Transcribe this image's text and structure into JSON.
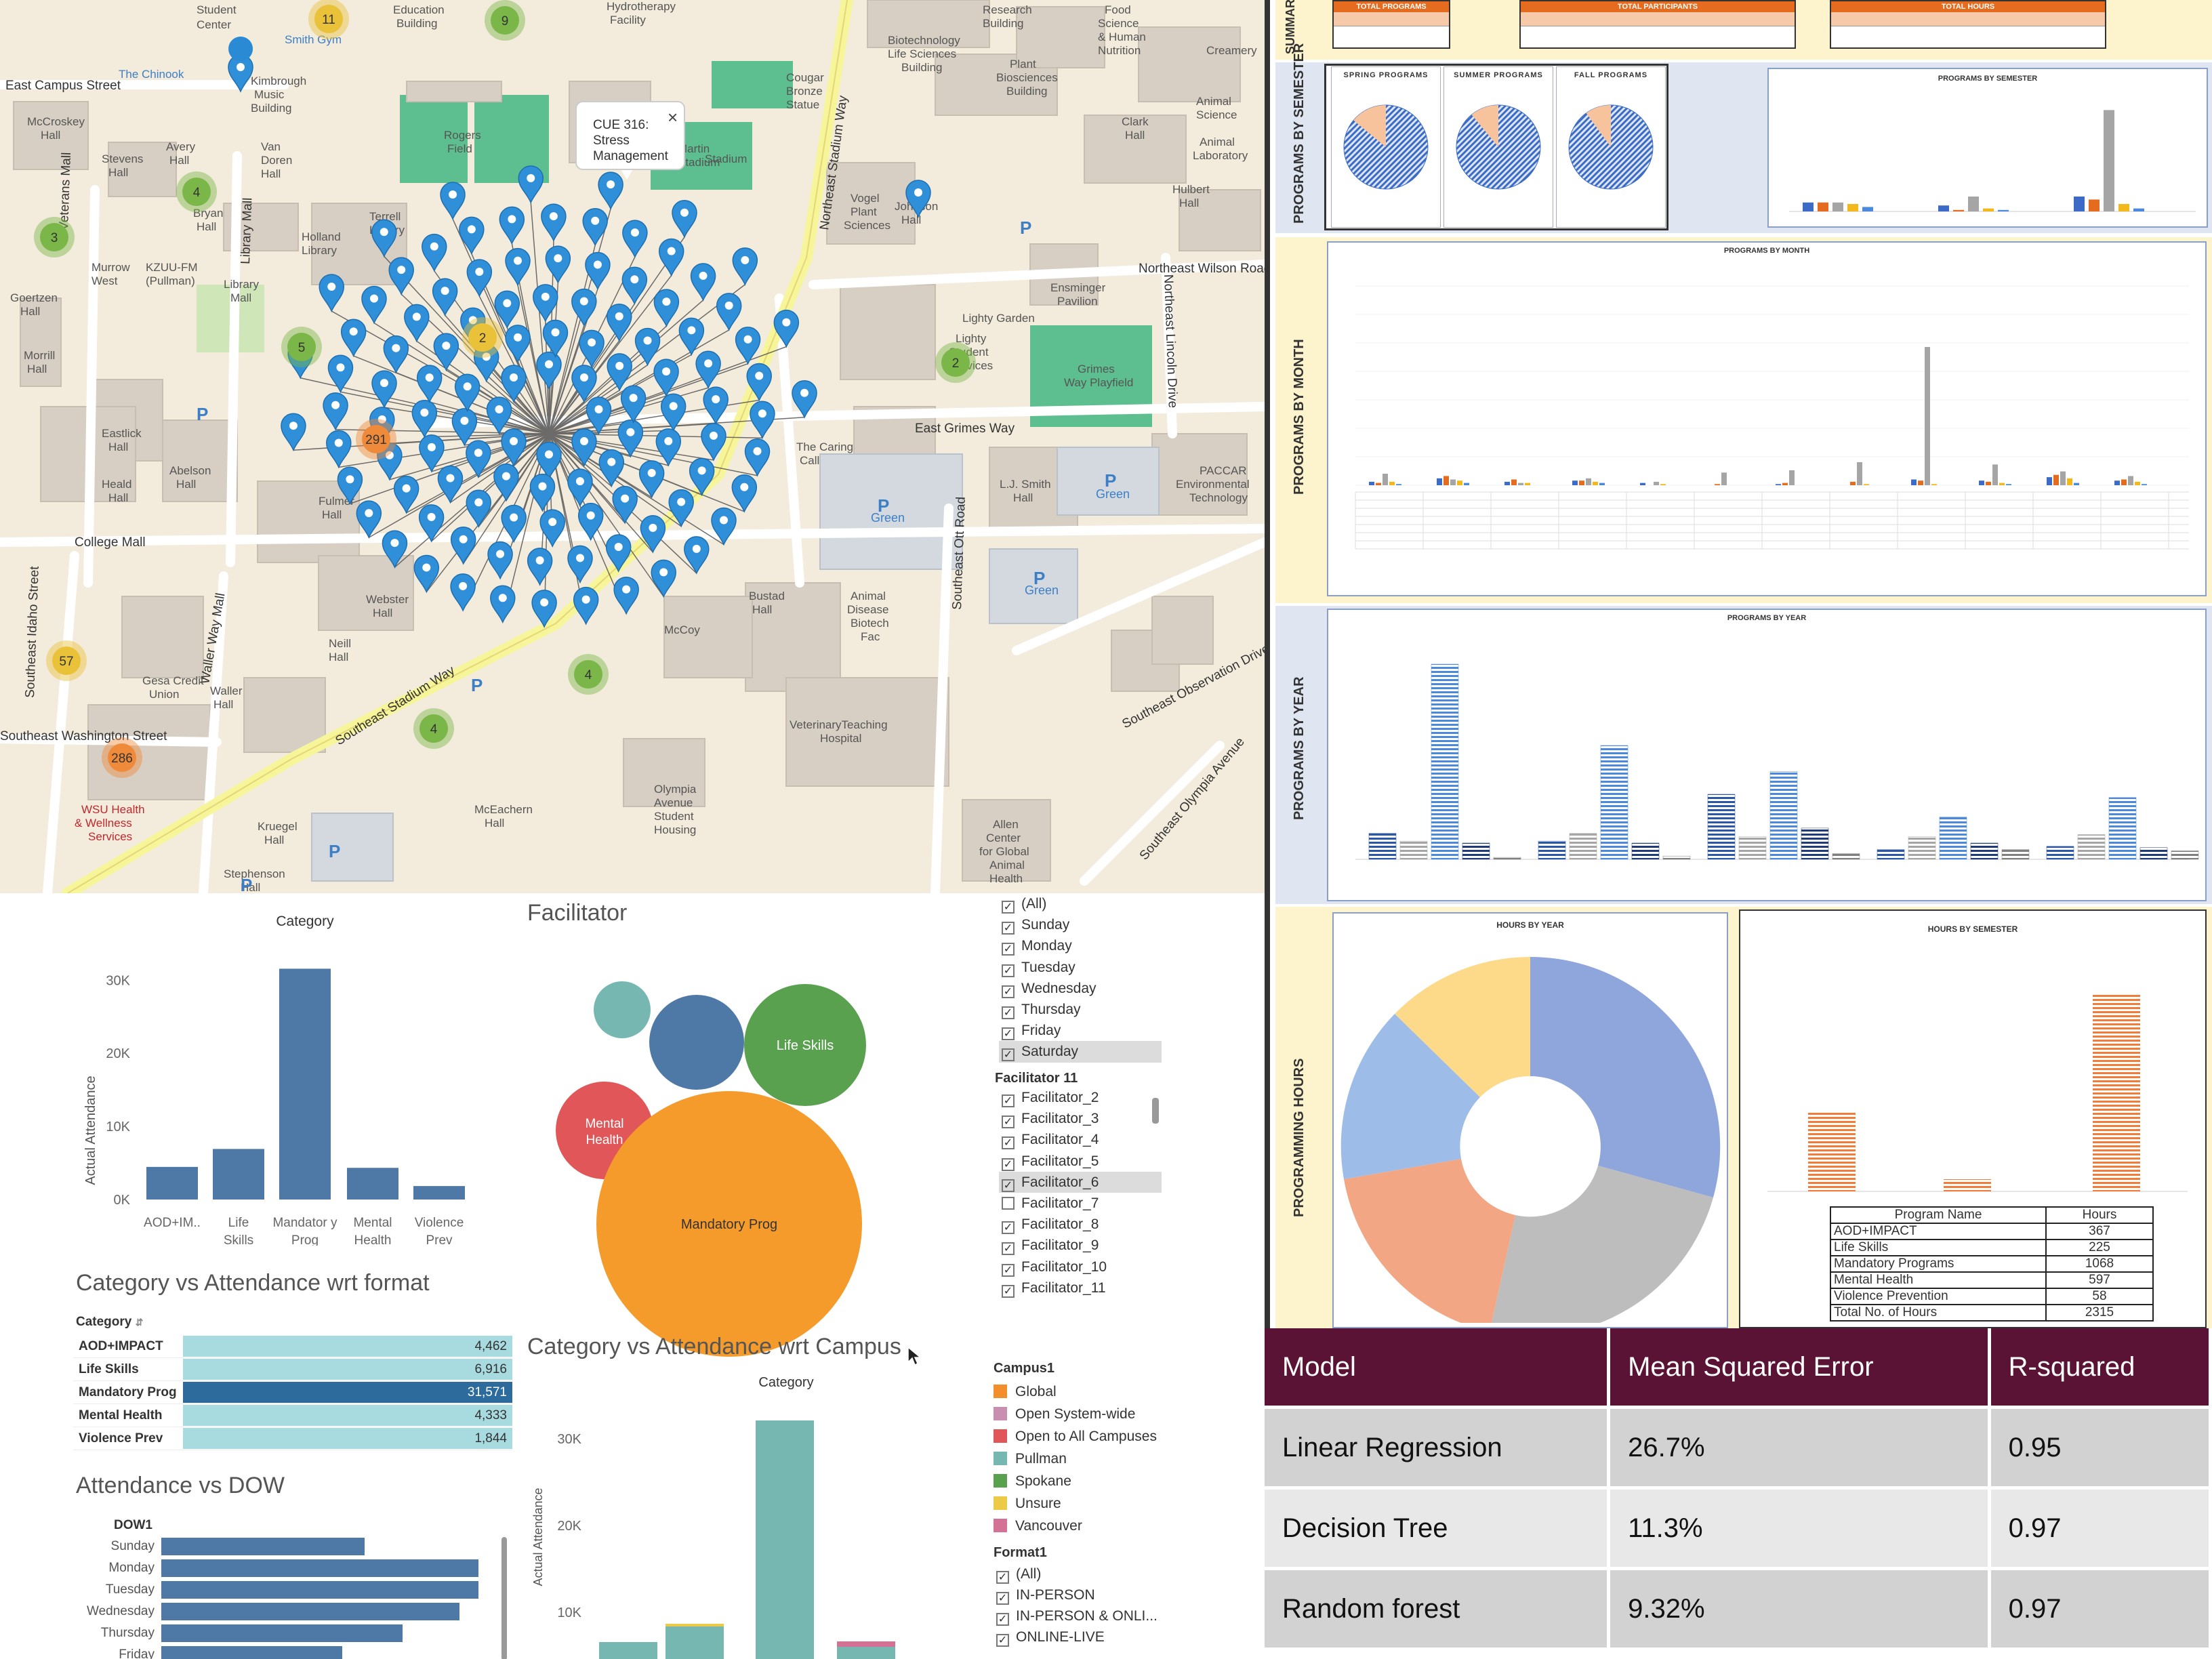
{
  "map": {
    "popup": {
      "line1": "CUE 316:",
      "line2": "Stress",
      "line3": "Management",
      "close": "×"
    },
    "streets": [
      "Northeast Stadium Way",
      "Northeast Wilson Road",
      "East Grimes Way",
      "College Mall",
      "Southeast Stadium Way",
      "Southeast Washington Street",
      "Northeast Lincoln Drive",
      "Southeast Olympia Avenue",
      "Southeast Observation Drive",
      "Southeast Ott Road",
      "East Campus Street",
      "Veterans Mall",
      "Library Mall",
      "Waller Way Mall",
      "Southeast Idaho Street"
    ],
    "buildings": [
      "Rogers Field",
      "Martin Stadium",
      "Holland Library",
      "Terrell Library",
      "Library Mall",
      "KZUU-FM (Pullman)",
      "Murrow West",
      "Goertzen Hall",
      "Morrill Hall",
      "Eastlick Hall",
      "Heald Hall",
      "Abelson Hall",
      "Webster Hall",
      "Fulmer Hall",
      "Bustad Hall",
      "McCoy",
      "Animal Disease Biotech Fac",
      "VeterinaryTeaching Hospital",
      "Olympia Avenue Student Housing",
      "Allen Center for Global Animal Health",
      "L.J. Smith Hall",
      "PACCAR Environmental Technology",
      "Grimes Way Playfield",
      "Ensminger Pavilion",
      "Clark Hall",
      "Animal Science",
      "Animal Laboratory",
      "Hulbert Hall",
      "Vogel Plant Sciences",
      "Johnson Hall",
      "Plant Biosciences Building",
      "Biotechnology Life Sciences Building",
      "Food Science & Human Nutrition",
      "Creamery",
      "Research Building",
      "Kimbrough Music Building",
      "McCroskey Hall",
      "Stevens Hall",
      "Avery Hall",
      "Bryan Hall",
      "Van Doren Hall",
      "Gesa Credit Union",
      "Kruegel Hall",
      "Waller Hall",
      "Neill Hall",
      "Stephenson Hall",
      "McEachern Hall",
      "WSU Health & Wellness Services",
      "The Chinook",
      "Student Center",
      "Education Building",
      "Hydrotherapy Facility",
      "The Caring Call",
      "Cougar Bronze Statue",
      "Lighty Student Services",
      "Lighty Garden",
      "Smith Gym"
    ],
    "clusters": [
      {
        "count": "11",
        "color": "#e9c23a"
      },
      {
        "count": "9",
        "color": "#7ab648"
      },
      {
        "count": "4",
        "color": "#7ab648"
      },
      {
        "count": "3",
        "color": "#7ab648"
      },
      {
        "count": "5",
        "color": "#7ab648"
      },
      {
        "count": "2",
        "color": "#7ab648"
      },
      {
        "count": "291",
        "color": "#ef8a3b"
      },
      {
        "count": "57",
        "color": "#e9c23a"
      },
      {
        "count": "286",
        "color": "#ef8a3b"
      },
      {
        "count": "4",
        "color": "#7ab648"
      },
      {
        "count": "4",
        "color": "#7ab648"
      },
      {
        "count": "2",
        "color": "#e9c23a"
      }
    ],
    "parking": [
      "P",
      "P",
      "P Green",
      "P Green",
      "P Green 1",
      "P"
    ]
  },
  "dashboard": {
    "category_chart": {
      "title": "Category",
      "ylabel": "Actual Attendance",
      "yticks": [
        "30K",
        "20K",
        "10K",
        "0K"
      ],
      "categories": [
        "AOD+IM..",
        "Life Skills",
        "Mandator y Prog",
        "Mental Health",
        "Violence Prev"
      ],
      "values": [
        4462,
        6916,
        31571,
        4333,
        1844
      ],
      "color": "#4e79a7"
    },
    "facilitator": {
      "title": "Facilitator",
      "bubbles": [
        {
          "label": "",
          "color": "#76b7b2"
        },
        {
          "label": "",
          "color": "#4e79a7"
        },
        {
          "label": "Life Skills",
          "color": "#59a14f"
        },
        {
          "label": "Mental Health",
          "color": "#e15759"
        },
        {
          "label": "Mandatory Prog",
          "color": "#f59b2b"
        }
      ]
    },
    "dow_filter": {
      "items": [
        {
          "label": "(All)",
          "checked": true
        },
        {
          "label": "Sunday",
          "checked": true
        },
        {
          "label": "Monday",
          "checked": true
        },
        {
          "label": "Tuesday",
          "checked": true
        },
        {
          "label": "Wednesday",
          "checked": true
        },
        {
          "label": "Thursday",
          "checked": true
        },
        {
          "label": "Friday",
          "checked": true
        },
        {
          "label": "Saturday",
          "checked": true
        }
      ]
    },
    "facilitator_filter": {
      "title": "Facilitator 11",
      "items": [
        {
          "label": "Facilitator_2",
          "checked": true
        },
        {
          "label": "Facilitator_3",
          "checked": true
        },
        {
          "label": "Facilitator_4",
          "checked": true
        },
        {
          "label": "Facilitator_5",
          "checked": true
        },
        {
          "label": "Facilitator_6",
          "checked": true
        },
        {
          "label": "Facilitator_7",
          "checked": false
        },
        {
          "label": "Facilitator_8",
          "checked": true
        },
        {
          "label": "Facilitator_9",
          "checked": true
        },
        {
          "label": "Facilitator_10",
          "checked": true
        },
        {
          "label": "Facilitator_11",
          "checked": true
        }
      ]
    },
    "format_table": {
      "title": "Category vs Attendance wrt format",
      "header": "Category",
      "rows": [
        {
          "category": "AOD+IMPACT",
          "value": "4,462",
          "fraction": 0.141
        },
        {
          "category": "Life Skills",
          "value": "6,916",
          "fraction": 0.219
        },
        {
          "category": "Mandatory Prog",
          "value": "31,571",
          "fraction": 1.0
        },
        {
          "category": "Mental Health",
          "value": "4,333",
          "fraction": 0.137
        },
        {
          "category": "Violence Prev",
          "value": "1,844",
          "fraction": 0.058
        }
      ]
    },
    "campus_chart": {
      "title": "Category vs Attendance wrt Campus",
      "subtitle": "Category",
      "ylabel": "Actual Attendance",
      "yticks": [
        "30K",
        "20K",
        "10K"
      ]
    },
    "campus_legend": {
      "title": "Campus1",
      "items": [
        {
          "label": "Global",
          "color": "#f28e2b"
        },
        {
          "label": "Open System-wide",
          "color": "#c98fb0"
        },
        {
          "label": "Open to All Campuses",
          "color": "#e15759"
        },
        {
          "label": "Pullman",
          "color": "#76b7b2"
        },
        {
          "label": "Spokane",
          "color": "#59a14f"
        },
        {
          "label": "Unsure",
          "color": "#edc948"
        },
        {
          "label": "Vancouver",
          "color": "#d37295"
        }
      ]
    },
    "format_filter": {
      "title": "Format1",
      "items": [
        {
          "label": "(All)",
          "checked": true
        },
        {
          "label": "IN-PERSON",
          "checked": true
        },
        {
          "label": "IN-PERSON & ONLI...",
          "checked": true
        },
        {
          "label": "ONLINE-LIVE",
          "checked": true
        }
      ]
    },
    "dow_chart": {
      "title": "Attendance vs DOW",
      "header": "DOW1",
      "days": [
        "Sunday",
        "Monday",
        "Tuesday",
        "Wednesday",
        "Thursday",
        "Friday"
      ],
      "fractions": [
        0.64,
        1.0,
        1.0,
        0.94,
        0.76,
        0.57
      ]
    }
  },
  "report": {
    "summary_label": "SUMMARY",
    "summary_heads": [
      "TOTAL PROGRAMS",
      "TOTAL PARTICIPANTS",
      "TOTAL HOURS"
    ],
    "semester_label": "PROGRAMS BY SEMESTER",
    "pies": [
      "SPRING PROGRAMS",
      "SUMMER PROGRAMS",
      "FALL PROGRAMS"
    ],
    "sem_bar_title": "PROGRAMS BY SEMESTER",
    "month_label": "PROGRAMS BY MONTH",
    "month_title": "PROGRAMS BY MONTH",
    "year_label": "PROGRAMS BY YEAR",
    "year_title": "PROGRAMS BY YEAR",
    "hours_label": "PROGRAMMING HOURS",
    "hours_year_title": "HOURS BY YEAR",
    "hours_sem_title": "HOURS BY SEMESTER",
    "hours_table": {
      "headers": [
        "Program Name",
        "Hours"
      ],
      "rows": [
        [
          "AOD+IMPACT",
          "367"
        ],
        [
          "Life Skills",
          "225"
        ],
        [
          "Mandatory Programs",
          "1068"
        ],
        [
          "Mental Health",
          "597"
        ],
        [
          "Violence Prevention",
          "58"
        ],
        [
          "Total No. of Hours",
          "2315"
        ]
      ]
    }
  },
  "models": {
    "headers": [
      "Model",
      "Mean Squared Error",
      "R-squared"
    ],
    "rows": [
      [
        "Linear Regression",
        "26.7%",
        "0.95"
      ],
      [
        "Decision Tree",
        "11.3%",
        "0.97"
      ],
      [
        "Random forest",
        "9.32%",
        "0.97"
      ]
    ]
  }
}
